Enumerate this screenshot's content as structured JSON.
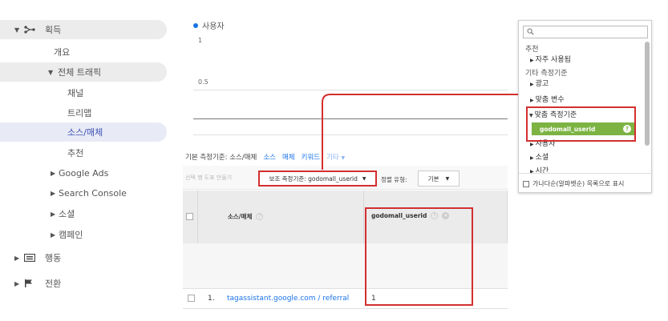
{
  "sidebar": {
    "acquisition": "획득",
    "overview": "개요",
    "all_traffic": "전체 트래픽",
    "channels": "채널",
    "treemap": "트리맵",
    "source_medium": "소스/매체",
    "referrals": "추천",
    "google_ads": "Google Ads",
    "search_console": "Search Console",
    "social": "소셜",
    "campaigns": "캠페인",
    "behavior": "행동",
    "conversions": "전환"
  },
  "chart": {
    "legend": "사용자",
    "y_top": "1",
    "y_mid": "0.5",
    "accent": "#1a73e8"
  },
  "dimension_bar": {
    "primary_label": "기본 측정기준: 소스/매체",
    "source": "소스",
    "medium": "매체",
    "keyword": "키워드",
    "other": "기타"
  },
  "toolbar": {
    "plot_rows": "선택 행 도표 만들기",
    "secondary_dimension": "보조 측정기준: godomall_userid",
    "sort_type_label": "정렬 유형:",
    "sort_value": "기본"
  },
  "table": {
    "col_source_medium": "소스/매체",
    "col_userid": "godomall_userid",
    "rows": [
      {
        "index": "1.",
        "source_medium": "tagassistant.google.com / referral",
        "userid": "1"
      }
    ]
  },
  "dropdown": {
    "search_placeholder": "",
    "recommended": "추천",
    "frequently_used": "자주 사용됨",
    "other_dimensions": "기타 측정기준",
    "ads": "광고",
    "custom_variables": "맞춤 변수",
    "custom_dimensions": "맞춤 측정기준",
    "godomall_userid": "godomall_userid",
    "users": "사용자",
    "social": "소셜",
    "time": "시간",
    "alphabetical": "가나다순(알파벳순) 목록으로 표시"
  }
}
